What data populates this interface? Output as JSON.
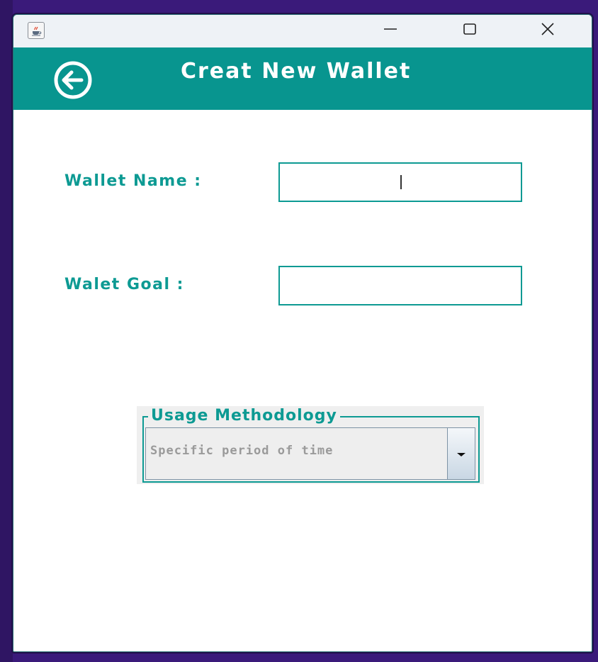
{
  "window": {
    "title": "",
    "java_icon": "java-cup-icon",
    "minimize_icon": "minimize-icon",
    "maximize_icon": "maximize-icon",
    "close_icon": "close-icon"
  },
  "header": {
    "title": "Creat New Wallet",
    "back_icon": "back-arrow-icon",
    "background": "#08958f"
  },
  "form": {
    "wallet_name_label": "Wallet Name :",
    "wallet_name_value": "",
    "wallet_goal_label": "Walet Goal :",
    "wallet_goal_value": ""
  },
  "usage": {
    "legend": "Usage Methodology",
    "selected": "Specific period of time",
    "dropdown_icon": "chevron-down-icon"
  },
  "colors": {
    "accent": "#0d9a93",
    "header": "#08958f",
    "field_text_placeholder": "#9a9a9a"
  }
}
